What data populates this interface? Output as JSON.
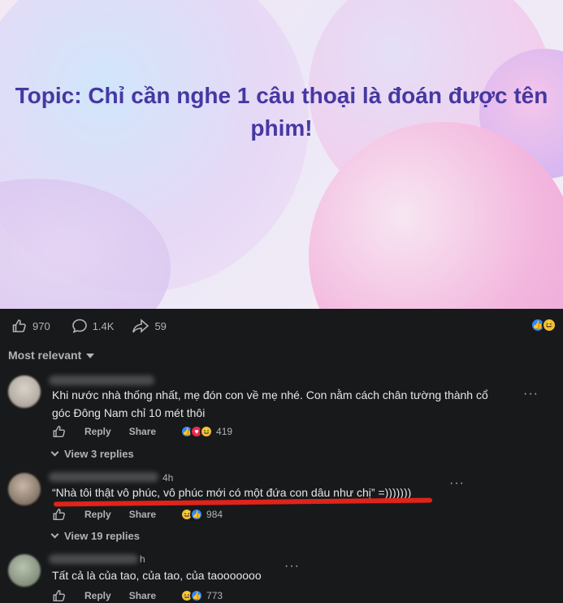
{
  "banner": {
    "title": "Topic: Chỉ cần nghe 1 câu thoại là đoán được tên phim!"
  },
  "post_actions": {
    "likes": "970",
    "comments": "1.4K",
    "shares": "59"
  },
  "sort": {
    "label": "Most relevant"
  },
  "comments": [
    {
      "text_line1": "Khi nước nhà thống nhất, mẹ đón con về mẹ nhé. Con nằm cách chân tường thành cổ",
      "text_line2": "góc Đông Nam chỉ 10 mét thôi",
      "time": "",
      "reply_label": "Reply",
      "share_label": "Share",
      "reaction_count": "419",
      "view_replies": "View 3 replies"
    },
    {
      "text_line1": "“Nhà tôi thật vô phúc, vô phúc mới có một đứa con dâu như chị” =)))))))",
      "time": "4h",
      "reply_label": "Reply",
      "share_label": "Share",
      "reaction_count": "984",
      "view_replies": "View 19 replies"
    },
    {
      "text_line1": "Tất cả là của tao, của tao, của taooooooo",
      "time": "h",
      "reply_label": "Reply",
      "share_label": "Share",
      "reaction_count": "773"
    }
  ],
  "colors": {
    "title": "#4638a2",
    "background": "#18191a",
    "muted": "#b0b3b8",
    "accent_like": "#2d88ff",
    "highlight": "#e0231b"
  }
}
